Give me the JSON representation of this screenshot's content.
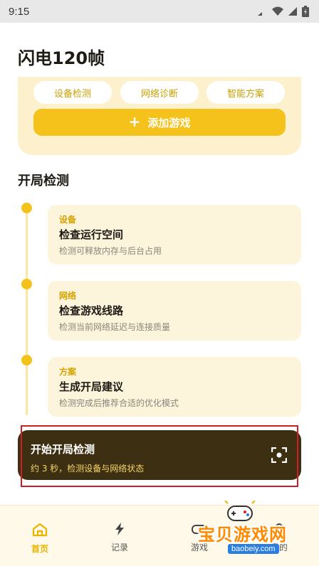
{
  "status_bar": {
    "time": "9:15"
  },
  "app_title": "闪电120帧",
  "quick_actions": [
    "设备检测",
    "网络诊断",
    "智能方案"
  ],
  "add_game": {
    "icon": "+",
    "label": "添加游戏"
  },
  "section_title": "开局检测",
  "steps": [
    {
      "tag": "设备",
      "title": "检查运行空间",
      "desc": "检测可释放内存与后台占用"
    },
    {
      "tag": "网络",
      "title": "检查游戏线路",
      "desc": "检测当前网络延迟与连接质量"
    },
    {
      "tag": "方案",
      "title": "生成开局建议",
      "desc": "检测完成后推荐合适的优化模式"
    }
  ],
  "start_detection": {
    "title": "开始开局检测",
    "subtitle": "约 3 秒，检测设备与网络状态"
  },
  "bottom_nav": [
    {
      "label": "首页",
      "icon": "home-icon",
      "active": true
    },
    {
      "label": "记录",
      "icon": "lightning-icon",
      "active": false
    },
    {
      "label": "游戏",
      "icon": "gamepad-icon",
      "active": false
    },
    {
      "label": "我的",
      "icon": "user-icon",
      "active": false
    }
  ],
  "watermark": {
    "text": "宝贝游戏网",
    "url": "baobeiy.com"
  },
  "colors": {
    "accent": "#f5c21b",
    "dark_bar": "#3d2f12",
    "card_bg": "#fdf4dc"
  }
}
